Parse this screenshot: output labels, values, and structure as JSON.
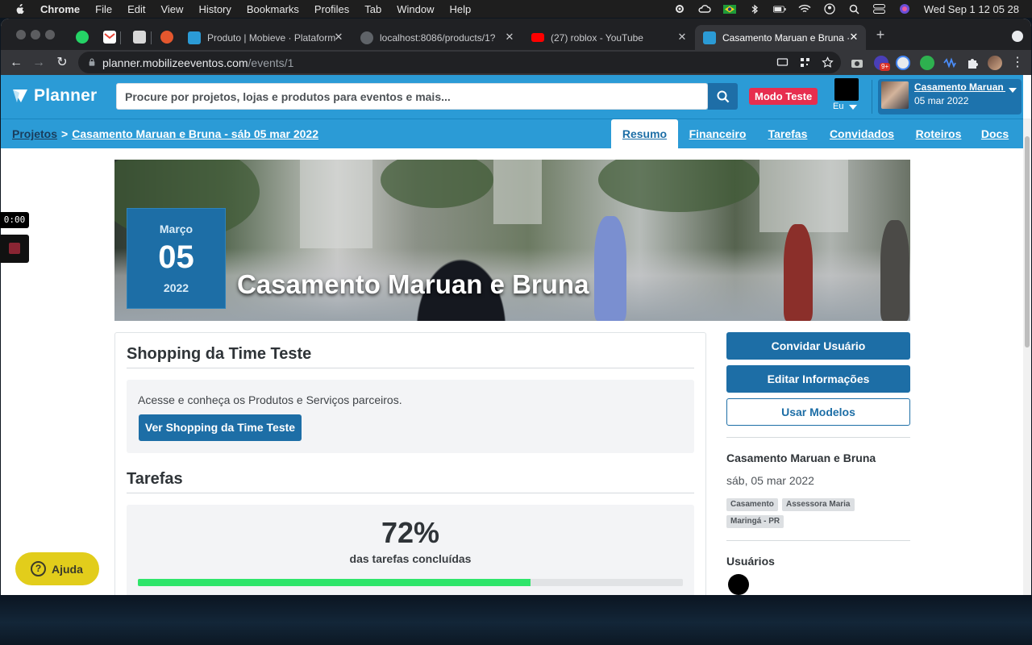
{
  "menubar": {
    "app": "Chrome",
    "items": [
      "File",
      "Edit",
      "View",
      "History",
      "Bookmarks",
      "Profiles",
      "Tab",
      "Window",
      "Help"
    ],
    "clock": "Wed Sep 1  12 05 28"
  },
  "browser": {
    "tabs": [
      {
        "title": "Produto | Mobieve · Plataforma"
      },
      {
        "title": "localhost:8086/products/1?"
      },
      {
        "title": "(27) roblox - YouTube"
      },
      {
        "title": "Casamento Maruan e Bruna · sáb"
      }
    ],
    "url_host": "planner.mobilizeeventos.com",
    "url_path": "/events/1",
    "extension_badge": "9+"
  },
  "header": {
    "logo": "Planner",
    "search_placeholder": "Procure por projetos, lojas e produtos para eventos e mais...",
    "mode_badge": "Modo Teste",
    "me_label": "Eu",
    "user_name": "Casamento Maruan e Bruna",
    "user_date": "05 mar 2022"
  },
  "breadcrumb": {
    "root": "Projetos",
    "separator": ">",
    "current": "Casamento Maruan e Bruna - sáb 05 mar 2022"
  },
  "tabs": [
    "Resumo",
    "Financeiro",
    "Tarefas",
    "Convidados",
    "Roteiros",
    "Docs"
  ],
  "active_tab": "Resumo",
  "hero": {
    "month": "Março",
    "day": "05",
    "year": "2022",
    "title": "Casamento Maruan e Bruna"
  },
  "shopping": {
    "heading": "Shopping da Time Teste",
    "text": "Acesse e conheça os Produtos e Serviços parceiros.",
    "button": "Ver Shopping da Time Teste"
  },
  "tasks": {
    "heading": "Tarefas",
    "percent_text": "72%",
    "progress": 0.72,
    "label": "das tarefas concluídas"
  },
  "sidebar": {
    "buttons": [
      "Convidar Usuário",
      "Editar Informações",
      "Usar Modelos"
    ],
    "event_name": "Casamento Maruan e Bruna",
    "event_date": "sáb, 05 mar 2022",
    "tags": [
      "Casamento",
      "Assessora Maria",
      "Maringá - PR"
    ],
    "users_heading": "Usuários"
  },
  "recorder": {
    "time": "0:00"
  },
  "help": {
    "label": "Ajuda"
  },
  "colors": {
    "brand_blue": "#2b9bd6",
    "button_blue": "#1d6ea6",
    "mode_red": "#e72e4f",
    "progress_green": "#2ee56a",
    "help_yellow": "#e2cd1b"
  }
}
